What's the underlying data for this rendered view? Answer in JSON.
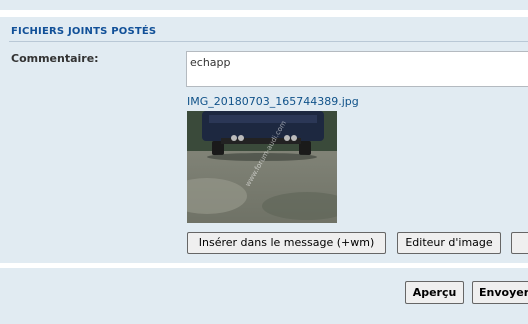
{
  "attachments": {
    "section_title": "FICHIERS JOINTS POSTÉS",
    "comment_label": "Commentaire:",
    "comment_value": "echapp",
    "filename": "IMG_20180703_165744389.jpg",
    "watermark_text": "www.forum-audi.com",
    "buttons": {
      "insert": "Insérer dans le message (+wm)",
      "editor": "Editeur d'image"
    }
  },
  "footer": {
    "preview": "Aperçu",
    "send": "Envoyer"
  },
  "colors": {
    "panel_bg": "#e1ebf2",
    "title_blue": "#115098",
    "link_blue": "#105289"
  }
}
